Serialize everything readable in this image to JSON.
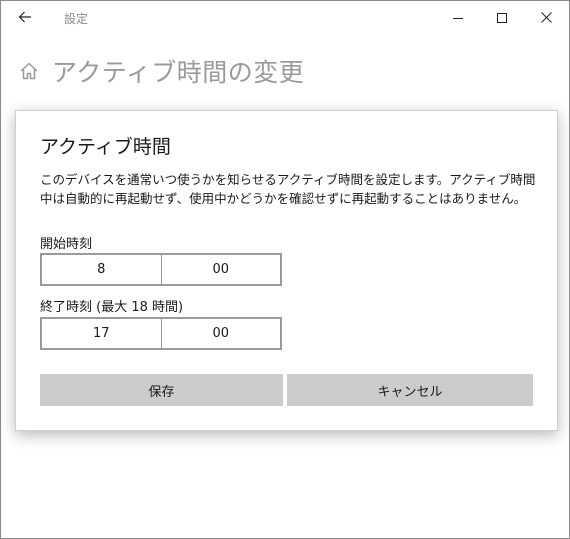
{
  "window": {
    "app_title": "設定"
  },
  "page": {
    "title": "アクティブ時間の変更"
  },
  "dialog": {
    "title": "アクティブ時間",
    "description": "このデバイスを通常いつ使うかを知らせるアクティブ時間を設定します。アクティブ時間中は自動的に再起動せず、使用中かどうかを確認せずに再起動することはありません。",
    "start": {
      "label": "開始時刻",
      "hour": "8",
      "minute": "00"
    },
    "end": {
      "label": "終了時刻 (最大 18 時間)",
      "hour": "17",
      "minute": "00"
    },
    "save_label": "保存",
    "cancel_label": "キャンセル"
  }
}
